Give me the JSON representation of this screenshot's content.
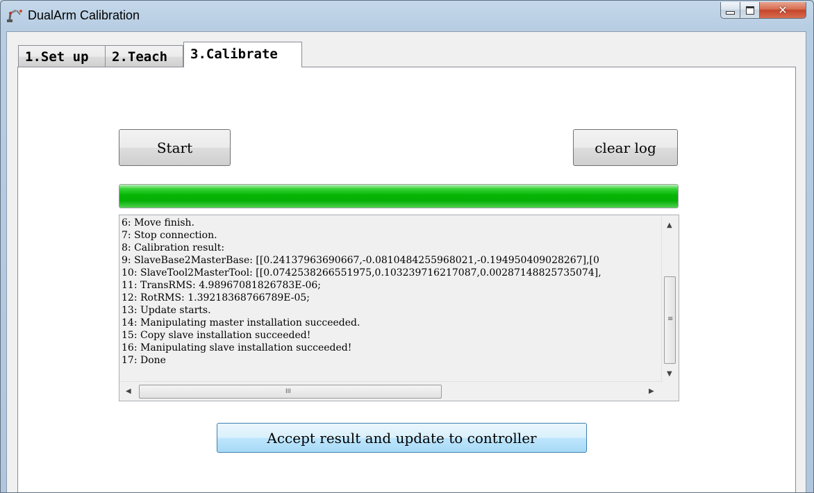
{
  "window": {
    "title": "DualArm Calibration",
    "close_glyph": "✕"
  },
  "tabs": [
    {
      "label": "1.Set up",
      "active": false
    },
    {
      "label": "2.Teach",
      "active": false
    },
    {
      "label": "3.Calibrate",
      "active": true
    }
  ],
  "buttons": {
    "start": "Start",
    "clear_log": "clear log",
    "accept": "Accept result and update to controller"
  },
  "progress": {
    "value_percent": 100,
    "color": "#06b506"
  },
  "log": {
    "lines": [
      "6: Move finish.",
      "7: Stop connection.",
      "8: Calibration result:",
      "9: SlaveBase2MasterBase: [[0.24137963690667,-0.0810484255968021,-0.194950409028267],[0",
      "10: SlaveTool2MasterTool: [[0.0742538266551975,0.103239716217087,0.00287148825735074],",
      "11: TransRMS: 4.98967081826783E-06;",
      "12: RotRMS: 1.39218368766789E-05;",
      "13: Update starts.",
      "14: Manipulating master installation succeeded.",
      "15: Copy slave installation succeeded!",
      "16: Manipulating slave installation succeeded!",
      "17: Done"
    ]
  },
  "scrollbars": {
    "vertical_grip": "≡",
    "horizontal_grip": "III",
    "up_arrow": "▲",
    "down_arrow": "▼",
    "left_arrow": "◀",
    "right_arrow": "▶"
  }
}
